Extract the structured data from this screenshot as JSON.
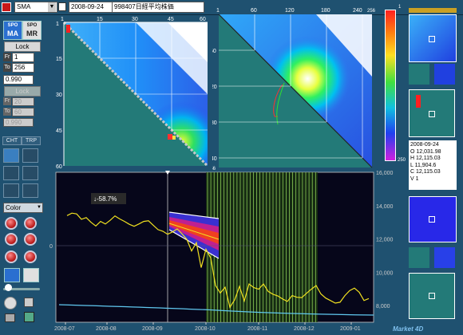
{
  "toolbar": {
    "indicator": "SMA",
    "date": "2008-09-24",
    "symbol": "998407日経平均株価"
  },
  "logo": {
    "spo_ma_top": "SPO",
    "spo_ma_bottom": "MA",
    "spo_mr_top": "SPO",
    "spo_mr_bottom": "MR"
  },
  "controls": {
    "lock_label": "Lock",
    "lock2_label": "Lock",
    "fr_label": "Fr",
    "to_label": "To",
    "fr_value": "1",
    "to_value": "256",
    "ratio_value": "0.990",
    "fr2_value": "20",
    "to2_value": "60",
    "ratio2_value": "0.990",
    "tab_cht": "CHT",
    "tab_trp": "TRP",
    "color_select": "Color"
  },
  "heatmap_left": {
    "top_ticks": [
      "1",
      "15",
      "30",
      "45",
      "60"
    ],
    "left_ticks": [
      "1",
      "15",
      "30",
      "45",
      "60"
    ]
  },
  "heatmap_right": {
    "top_ticks": [
      "1",
      "60",
      "120",
      "180",
      "240",
      "256"
    ],
    "left_ticks": [
      "60",
      "120",
      "180",
      "240",
      "256"
    ]
  },
  "colorbar": {
    "top": "1",
    "bottom": "250"
  },
  "info": {
    "date": "2008-09-24",
    "open": "O  12,031.98",
    "high": "H  12,115.03",
    "low": "L  11,904.6",
    "close": "C  12,115.03",
    "volume": "V  1"
  },
  "brand": "Market 4D",
  "chart_data": {
    "type": "line",
    "series_label": "↓-58.7%",
    "x_labels": [
      "2008-07",
      "2008-08",
      "2008-09",
      "2008-10",
      "2008-11",
      "2008-12",
      "2009-01"
    ],
    "right_axis": [
      "16,000",
      "14,000",
      "12,000",
      "10,000",
      "8,000"
    ],
    "left_axis": [
      "0"
    ],
    "ylim": [
      7000,
      16000
    ],
    "series": [
      {
        "color": "#f0e020",
        "values": [
          13400,
          13550,
          13500,
          13180,
          13280,
          13000,
          12780,
          13050,
          12900,
          13120,
          13380,
          13200,
          13050,
          12880,
          12760,
          12900,
          13050,
          13090,
          12820,
          12560,
          12460,
          12280,
          12420,
          12600,
          12310,
          11980,
          11280,
          11780,
          10280,
          11380,
          10860,
          9200,
          8750,
          9100,
          7900,
          8350,
          9150,
          8280,
          9300,
          9080,
          8980,
          9300,
          8850,
          8680,
          8580,
          8400,
          8250,
          8600,
          8500,
          8480,
          8740,
          8980,
          9200,
          8700,
          8450,
          8300,
          8150,
          8200,
          8600,
          8900,
          9050,
          8800,
          8300,
          8420
        ]
      }
    ]
  }
}
